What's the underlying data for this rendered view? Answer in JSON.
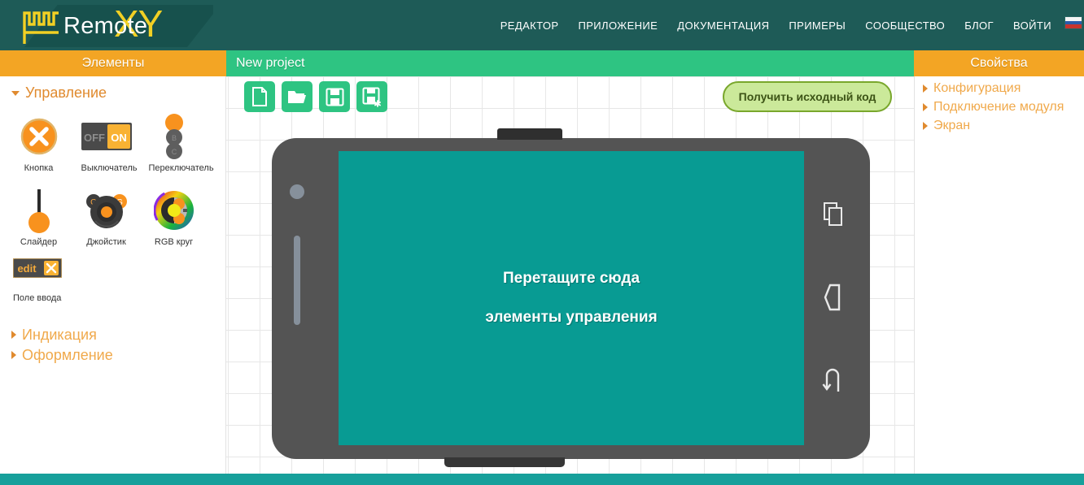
{
  "brand": {
    "name_text": "Remote",
    "name_suffix": "XY",
    "logo_icon": "square-wave-logo"
  },
  "nav": {
    "items": [
      {
        "label": "РЕДАКТОР",
        "name": "nav-editor"
      },
      {
        "label": "ПРИЛОЖЕНИЕ",
        "name": "nav-application"
      },
      {
        "label": "ДОКУМЕНТАЦИЯ",
        "name": "nav-documentation"
      },
      {
        "label": "ПРИМЕРЫ",
        "name": "nav-examples"
      },
      {
        "label": "СООБЩЕСТВО",
        "name": "nav-community"
      },
      {
        "label": "БЛОГ",
        "name": "nav-blog"
      },
      {
        "label": "ВОЙТИ",
        "name": "nav-login"
      }
    ],
    "flag": "russian-flag-icon"
  },
  "panels": {
    "left_title": "Элементы",
    "project_title": "New project",
    "right_title": "Свойства"
  },
  "elements_panel": {
    "group_label": "Управление",
    "items": [
      {
        "label": "Кнопка",
        "icon": "button-icon"
      },
      {
        "label": "Выключатель",
        "icon": "switch-icon"
      },
      {
        "label": "Переключатель",
        "icon": "selector-icon"
      },
      {
        "label": "Слайдер",
        "icon": "slider-icon"
      },
      {
        "label": "Джойстик",
        "icon": "joystick-icon"
      },
      {
        "label": "RGB круг",
        "icon": "rgb-wheel-icon"
      },
      {
        "label": "Поле ввода",
        "icon": "edit-field-icon"
      }
    ],
    "edit_field_text": "edit",
    "collapsed_sections": [
      {
        "label": "Индикация"
      },
      {
        "label": "Оформление"
      }
    ]
  },
  "toolbar": {
    "buttons": [
      {
        "name": "new-project-button",
        "icon": "new-file-icon"
      },
      {
        "name": "open-project-button",
        "icon": "open-folder-icon"
      },
      {
        "name": "save-project-button",
        "icon": "save-floppy-icon"
      },
      {
        "name": "save-as-project-button",
        "icon": "save-as-floppy-icon"
      }
    ],
    "source_code_label": "Получить исходный код"
  },
  "canvas": {
    "drop_hint_line1": "Перетащите сюда",
    "drop_hint_line2": "элементы управления",
    "phone_nav": [
      {
        "name": "recents-icon"
      },
      {
        "name": "back-icon"
      },
      {
        "name": "home-icon"
      }
    ]
  },
  "properties_panel": {
    "items": [
      {
        "label": "Конфигурация"
      },
      {
        "label": "Подключение модуля"
      },
      {
        "label": "Экран"
      }
    ]
  },
  "colors": {
    "topbar": "#1e5b57",
    "orange": "#f3a524",
    "green": "#2ec482",
    "screen_teal": "#089b93",
    "footer_teal": "#17a09b",
    "accent_yellow": "#f2d024"
  }
}
